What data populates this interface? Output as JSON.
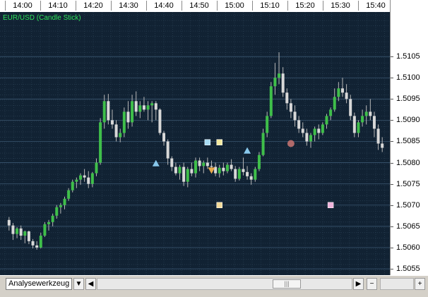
{
  "chart_data": {
    "type": "candlestick",
    "title": "EUR/USD (Candle Stick)",
    "time_labels": [
      "14:00",
      "14:10",
      "14:20",
      "14:30",
      "14:40",
      "14:50",
      "15:00",
      "15:10",
      "15:20",
      "15:30",
      "15:40"
    ],
    "y_ticks": [
      "1.5105",
      "1.5100",
      "1.5095",
      "1.5090",
      "1.5085",
      "1.5080",
      "1.5075",
      "1.5070",
      "1.5065",
      "1.5060",
      "1.5055"
    ],
    "ylim": [
      1.50535,
      1.51155
    ],
    "grid": true,
    "candles": [
      [
        1.50665,
        1.50672,
        1.5064,
        1.50652
      ],
      [
        1.50652,
        1.50658,
        1.50618,
        1.50632
      ],
      [
        1.50632,
        1.50648,
        1.50622,
        1.50645
      ],
      [
        1.50645,
        1.50652,
        1.50618,
        1.50628
      ],
      [
        1.50628,
        1.5064,
        1.5061,
        1.50638
      ],
      [
        1.50638,
        1.5064,
        1.50608,
        1.50615
      ],
      [
        1.50615,
        1.5062,
        1.50598,
        1.50605
      ],
      [
        1.50605,
        1.50615,
        1.50595,
        1.506
      ],
      [
        1.506,
        1.50635,
        1.50598,
        1.50628
      ],
      [
        1.50628,
        1.5066,
        1.50625,
        1.50655
      ],
      [
        1.50655,
        1.50665,
        1.5064,
        1.5066
      ],
      [
        1.5066,
        1.5068,
        1.5065,
        1.50675
      ],
      [
        1.50675,
        1.507,
        1.50668,
        1.50695
      ],
      [
        1.50695,
        1.50705,
        1.5068,
        1.507
      ],
      [
        1.507,
        1.5072,
        1.5069,
        1.50715
      ],
      [
        1.50715,
        1.5074,
        1.5071,
        1.50735
      ],
      [
        1.50735,
        1.5076,
        1.5073,
        1.50755
      ],
      [
        1.50755,
        1.50765,
        1.5074,
        1.5076
      ],
      [
        1.5076,
        1.50775,
        1.50748,
        1.5077
      ],
      [
        1.5077,
        1.50785,
        1.50755,
        1.50765
      ],
      [
        1.50765,
        1.5078,
        1.5074,
        1.5075
      ],
      [
        1.5075,
        1.50778,
        1.50742,
        1.50775
      ],
      [
        1.50775,
        1.5081,
        1.50768,
        1.508
      ],
      [
        1.508,
        1.50905,
        1.50795,
        1.50895
      ],
      [
        1.50895,
        1.5096,
        1.5088,
        1.50945
      ],
      [
        1.50945,
        1.50962,
        1.5089,
        1.509
      ],
      [
        1.509,
        1.50925,
        1.5088,
        1.5089
      ],
      [
        1.5089,
        1.509,
        1.5085,
        1.5086
      ],
      [
        1.5086,
        1.5088,
        1.50848,
        1.5087
      ],
      [
        1.5087,
        1.5093,
        1.5086,
        1.5092
      ],
      [
        1.5092,
        1.50945,
        1.5088,
        1.50895
      ],
      [
        1.50895,
        1.5096,
        1.50885,
        1.50945
      ],
      [
        1.50945,
        1.50968,
        1.5091,
        1.5092
      ],
      [
        1.5092,
        1.50945,
        1.50905,
        1.50935
      ],
      [
        1.50935,
        1.50955,
        1.5092,
        1.50925
      ],
      [
        1.50925,
        1.50945,
        1.509,
        1.50935
      ],
      [
        1.50935,
        1.50945,
        1.50895,
        1.5094
      ],
      [
        1.5094,
        1.50945,
        1.509,
        1.50925
      ],
      [
        1.50925,
        1.50928,
        1.50865,
        1.5087
      ],
      [
        1.5087,
        1.50875,
        1.5084,
        1.5085
      ],
      [
        1.5085,
        1.50855,
        1.50795,
        1.5081
      ],
      [
        1.5081,
        1.50815,
        1.5078,
        1.5079
      ],
      [
        1.5079,
        1.508,
        1.5077,
        1.50775
      ],
      [
        1.50775,
        1.50795,
        1.5076,
        1.5079
      ],
      [
        1.5079,
        1.508,
        1.50745,
        1.50755
      ],
      [
        1.50755,
        1.5079,
        1.50742,
        1.50785
      ],
      [
        1.50785,
        1.508,
        1.50768,
        1.50775
      ],
      [
        1.50775,
        1.50812,
        1.50765,
        1.50805
      ],
      [
        1.50805,
        1.50812,
        1.5078,
        1.50792
      ],
      [
        1.50792,
        1.50805,
        1.50775,
        1.508
      ],
      [
        1.508,
        1.50812,
        1.50785,
        1.50792
      ],
      [
        1.50792,
        1.50805,
        1.50775,
        1.5079
      ],
      [
        1.5079,
        1.508,
        1.50768,
        1.50775
      ],
      [
        1.50775,
        1.50795,
        1.50765,
        1.50788
      ],
      [
        1.50788,
        1.508,
        1.5077,
        1.5078
      ],
      [
        1.5078,
        1.508,
        1.50775,
        1.50795
      ],
      [
        1.50795,
        1.50808,
        1.5078,
        1.50785
      ],
      [
        1.50785,
        1.50792,
        1.50755,
        1.50762
      ],
      [
        1.50762,
        1.5079,
        1.50758,
        1.50785
      ],
      [
        1.50785,
        1.50812,
        1.5077,
        1.50778
      ],
      [
        1.50778,
        1.50792,
        1.5076,
        1.50768
      ],
      [
        1.50768,
        1.50775,
        1.50748,
        1.5076
      ],
      [
        1.5076,
        1.5079,
        1.50755,
        1.50785
      ],
      [
        1.50785,
        1.50825,
        1.5078,
        1.50818
      ],
      [
        1.50818,
        1.5088,
        1.50815,
        1.5087
      ],
      [
        1.5087,
        1.5092,
        1.5086,
        1.5091
      ],
      [
        1.5091,
        1.5099,
        1.50905,
        1.5098
      ],
      [
        1.5098,
        1.51035,
        1.5096,
        1.51
      ],
      [
        1.51,
        1.5106,
        1.50985,
        1.5101
      ],
      [
        1.5101,
        1.51025,
        1.50955,
        1.50965
      ],
      [
        1.50965,
        1.50975,
        1.50925,
        1.5094
      ],
      [
        1.5094,
        1.5095,
        1.50905,
        1.5092
      ],
      [
        1.5092,
        1.50935,
        1.50885,
        1.509
      ],
      [
        1.509,
        1.5091,
        1.5087,
        1.5088
      ],
      [
        1.5088,
        1.50895,
        1.5086,
        1.5087
      ],
      [
        1.5087,
        1.5088,
        1.5084,
        1.5085
      ],
      [
        1.5085,
        1.5087,
        1.50835,
        1.50865
      ],
      [
        1.50865,
        1.50885,
        1.5085,
        1.5088
      ],
      [
        1.5088,
        1.5089,
        1.50855,
        1.5087
      ],
      [
        1.5087,
        1.50895,
        1.50865,
        1.5089
      ],
      [
        1.5089,
        1.50915,
        1.5088,
        1.5091
      ],
      [
        1.5091,
        1.5093,
        1.509,
        1.50925
      ],
      [
        1.50925,
        1.50975,
        1.5092,
        1.50955
      ],
      [
        1.50955,
        1.5099,
        1.50945,
        1.50975
      ],
      [
        1.50975,
        1.51,
        1.50955,
        1.50965
      ],
      [
        1.50965,
        1.50985,
        1.5094,
        1.5095
      ],
      [
        1.5095,
        1.5096,
        1.509,
        1.5091
      ],
      [
        1.5091,
        1.50918,
        1.5086,
        1.5087
      ],
      [
        1.5087,
        1.509,
        1.5086,
        1.50895
      ],
      [
        1.50895,
        1.50925,
        1.50885,
        1.5091
      ],
      [
        1.5091,
        1.50935,
        1.5089,
        1.5092
      ],
      [
        1.5092,
        1.5095,
        1.509,
        1.5091
      ],
      [
        1.5091,
        1.5092,
        1.5086,
        1.5088
      ],
      [
        1.5088,
        1.5089,
        1.5083,
        1.50845
      ],
      [
        1.50845,
        1.5086,
        1.50825,
        1.50835
      ]
    ],
    "markers": [
      {
        "shape": "triangle-up",
        "color": "#88c8ec",
        "x_index": 37,
        "y": 1.50798
      },
      {
        "shape": "square",
        "color": "#a8dcf4",
        "x_index": 50,
        "y": 1.50848
      },
      {
        "shape": "square",
        "color": "#f4eaa0",
        "x_index": 53,
        "y": 1.50848
      },
      {
        "shape": "triangle-down",
        "color": "#e8a94a",
        "x_index": 51,
        "y": 1.50782
      },
      {
        "shape": "square",
        "color": "#f4dc9c",
        "x_index": 53,
        "y": 1.507
      },
      {
        "shape": "triangle-up",
        "color": "#88c8ec",
        "x_index": 60,
        "y": 1.50828
      },
      {
        "shape": "circle",
        "color": "#b06a6a",
        "x_index": 71,
        "y": 1.50845
      },
      {
        "shape": "square",
        "color": "#f0b4dc",
        "x_index": 81,
        "y": 1.507
      }
    ]
  },
  "colors": {
    "background": "#112233",
    "grid": "#2e4458",
    "bull": "#3fbf4a",
    "bear": "#d8d8d8",
    "title": "#2ee55a"
  },
  "toolbar": {
    "tool_label": "Analysewerkzeug",
    "dropdown_arrow": "▼",
    "scroll_left": "◀",
    "scroll_right": "▶",
    "thumb_grip": "|||",
    "zoom_out": "−",
    "zoom_in": "+"
  }
}
